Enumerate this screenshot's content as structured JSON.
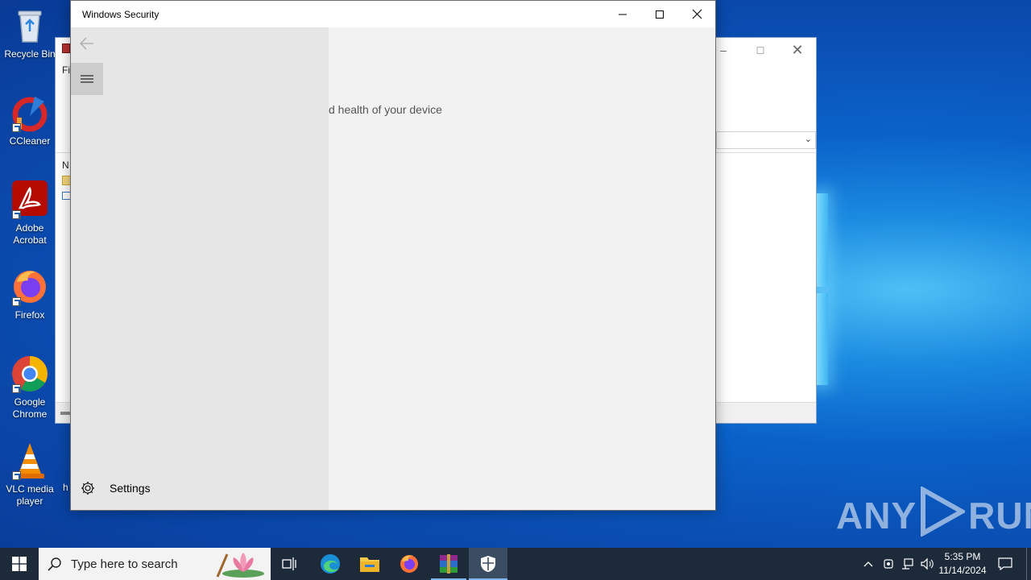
{
  "desktop": {
    "icons": [
      {
        "label": "Recycle Bin",
        "icon": "recycle-bin-icon"
      },
      {
        "label": "CCleaner",
        "icon": "ccleaner-icon"
      },
      {
        "label": "Adobe Acrobat",
        "icon": "adobe-acrobat-icon"
      },
      {
        "label": "Firefox",
        "icon": "firefox-icon"
      },
      {
        "label": "Google Chrome",
        "icon": "chrome-icon"
      },
      {
        "label": "VLC media player",
        "icon": "vlc-icon"
      }
    ],
    "partial_label": "h"
  },
  "background_window": {
    "menu_fragment": "Fi",
    "column_fragment": "N"
  },
  "security_window": {
    "title": "Windows Security",
    "subtitle_fragment": "d health of your device",
    "nav": {
      "settings_label": "Settings"
    }
  },
  "taskbar": {
    "search_placeholder": "Type here to search",
    "apps": [
      "task-view-icon",
      "edge-icon",
      "file-explorer-icon",
      "firefox-icon",
      "winrar-icon",
      "windows-security-icon"
    ],
    "clock_time": "5:35 PM",
    "clock_date": "11/14/2024"
  },
  "watermark": {
    "text_left": "ANY",
    "text_right": "RUN"
  },
  "colors": {
    "taskbar": "#1c2a3a",
    "nav_pane": "#e6e6e6",
    "content_pane": "#f2f2f2",
    "accent": "#7fb4ec"
  }
}
